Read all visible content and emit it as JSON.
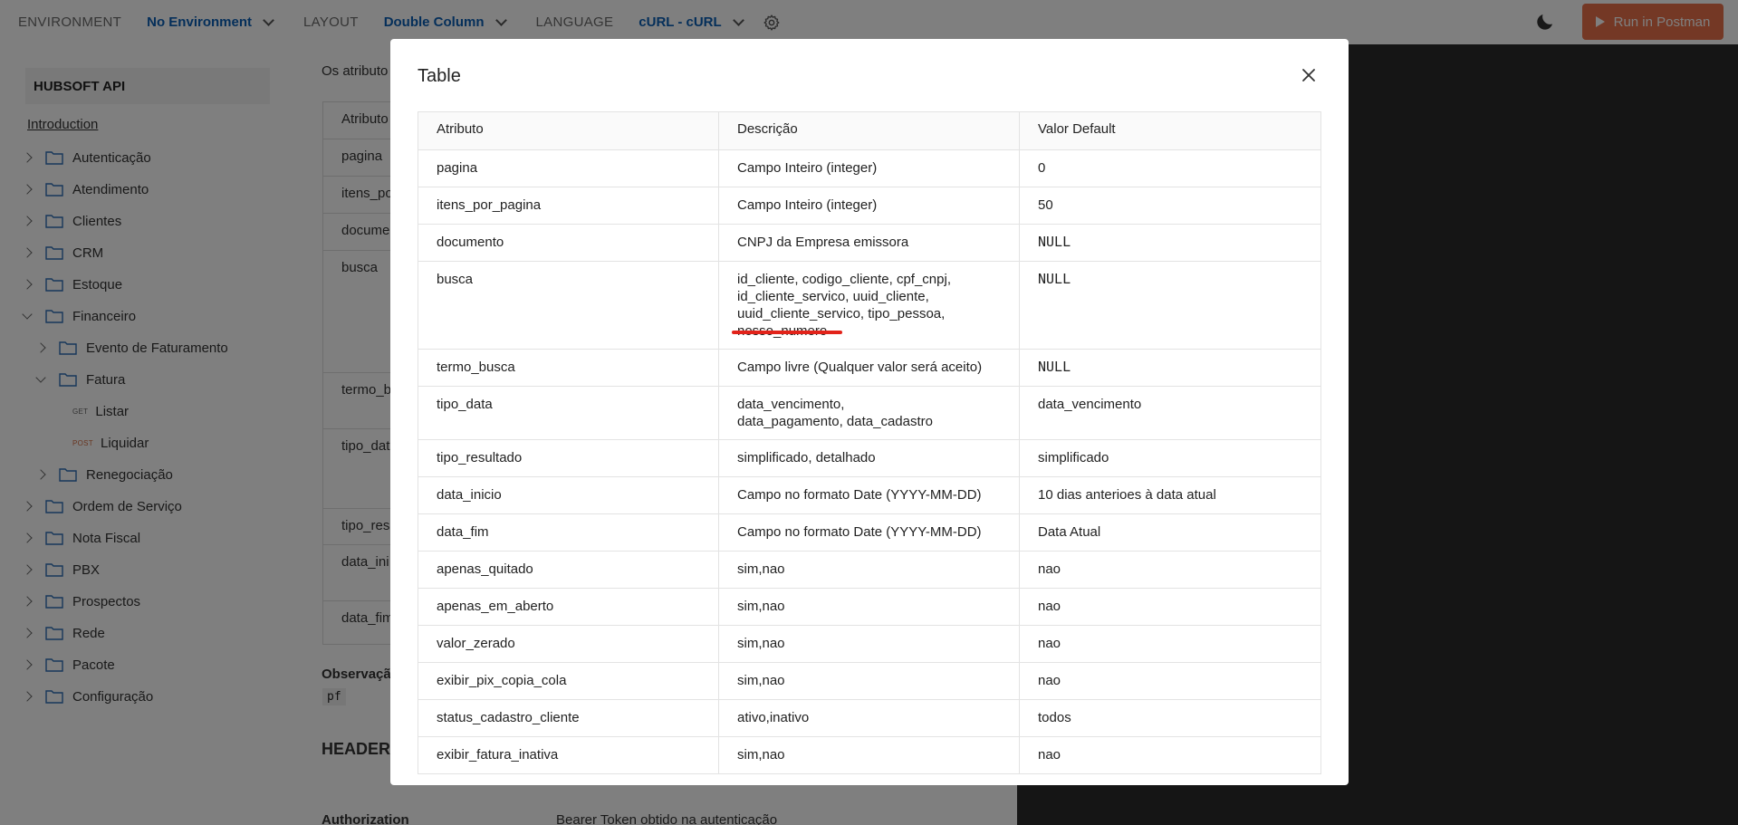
{
  "topbar": {
    "environment_label": "ENVIRONMENT",
    "environment_value": "No Environment",
    "layout_label": "LAYOUT",
    "layout_value": "Double Column",
    "language_label": "LANGUAGE",
    "language_value": "cURL - cURL",
    "run_button": "Run in Postman"
  },
  "sidebar": {
    "api_title": "HUBSOFT API",
    "intro": "Introduction",
    "items": [
      {
        "label": "Autenticação"
      },
      {
        "label": "Atendimento"
      },
      {
        "label": "Clientes"
      },
      {
        "label": "CRM"
      },
      {
        "label": "Estoque"
      },
      {
        "label": "Financeiro"
      },
      {
        "label": "Evento de Faturamento"
      },
      {
        "label": "Fatura"
      },
      {
        "label": "Listar",
        "method": "GET"
      },
      {
        "label": "Liquidar",
        "method": "POST"
      },
      {
        "label": "Renegociação"
      },
      {
        "label": "Ordem de Serviço"
      },
      {
        "label": "Nota Fiscal"
      },
      {
        "label": "PBX"
      },
      {
        "label": "Prospectos"
      },
      {
        "label": "Rede"
      },
      {
        "label": "Pacote"
      },
      {
        "label": "Configuração"
      }
    ]
  },
  "main": {
    "intro_text": "Os atributo",
    "bg_rows": [
      "Atributo",
      "pagina",
      "itens_po",
      "docume",
      "busca",
      "termo_b",
      "tipo_dat",
      "tipo_res",
      "data_ini",
      "data_fim"
    ],
    "obs_label": "Observaçã",
    "code": "pf",
    "headers_title": "HEADERS",
    "authorization_label": "Authorization",
    "authorization_value": "Bearer Token obtido na autenticação"
  },
  "modal": {
    "title": "Table",
    "columns": [
      "Atributo",
      "Descrição",
      "Valor Default"
    ],
    "rows": [
      [
        "pagina",
        "Campo Inteiro (integer)",
        "0"
      ],
      [
        "itens_por_pagina",
        "Campo Inteiro (integer)",
        "50"
      ],
      [
        "documento",
        "CNPJ da Empresa emissora",
        "NULL"
      ],
      [
        "busca",
        "id_cliente, codigo_cliente, cpf_cnpj, id_cliente_servico, uuid_cliente, uuid_cliente_servico, tipo_pessoa, nosso_numero",
        "NULL"
      ],
      [
        "termo_busca",
        "Campo livre (Qualquer valor será aceito)",
        "NULL"
      ],
      [
        "tipo_data",
        "data_vencimento, data_pagamento, data_cadastro",
        "data_vencimento"
      ],
      [
        "tipo_resultado",
        "simplificado, detalhado",
        "simplificado"
      ],
      [
        "data_inicio",
        "Campo no formato Date (YYYY-MM-DD)",
        "10 dias anterioes à data atual"
      ],
      [
        "data_fim",
        "Campo no formato Date (YYYY-MM-DD)",
        "Data Atual"
      ],
      [
        "apenas_quitado",
        "sim,nao",
        "nao"
      ],
      [
        "apenas_em_aberto",
        "sim,nao",
        "nao"
      ],
      [
        "valor_zerado",
        "sim,nao",
        "nao"
      ],
      [
        "exibir_pix_copia_cola",
        "sim,nao",
        "nao"
      ],
      [
        "status_cadastro_cliente",
        "ativo,inativo",
        "todos"
      ],
      [
        "exibir_fatura_inativa",
        "sim,nao",
        "nao"
      ]
    ]
  }
}
